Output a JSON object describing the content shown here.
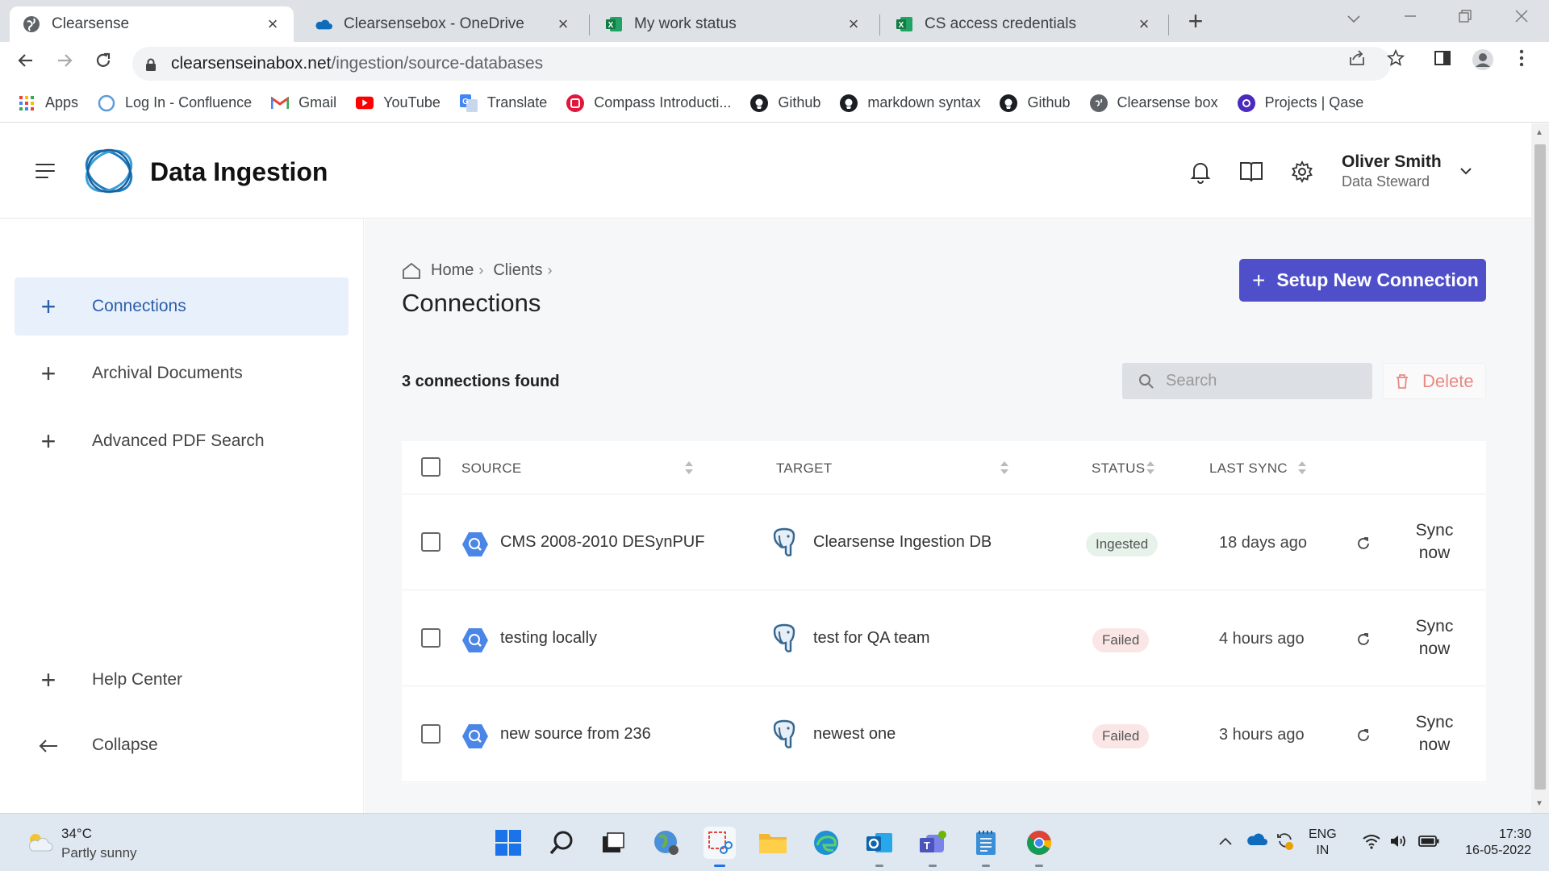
{
  "browser": {
    "tabs": [
      {
        "title": "Clearsense",
        "active": true
      },
      {
        "title": "Clearsensebox - OneDrive",
        "active": false
      },
      {
        "title": "My work status",
        "active": false
      },
      {
        "title": "CS access credentials",
        "active": false
      }
    ],
    "url_host": "clearsenseinabox.net",
    "url_path": "/ingestion/source-databases",
    "bookmarks": [
      {
        "label": "Apps",
        "icon": "apps-grid-icon"
      },
      {
        "label": "Log In - Confluence",
        "icon": "confluence-icon"
      },
      {
        "label": "Gmail",
        "icon": "gmail-icon"
      },
      {
        "label": "YouTube",
        "icon": "youtube-icon"
      },
      {
        "label": "Translate",
        "icon": "translate-icon"
      },
      {
        "label": "Compass Introducti...",
        "icon": "compass-icon"
      },
      {
        "label": "Github",
        "icon": "github-icon"
      },
      {
        "label": "markdown syntax",
        "icon": "github-icon"
      },
      {
        "label": "Github",
        "icon": "github-icon"
      },
      {
        "label": "Clearsense box",
        "icon": "globe-icon"
      },
      {
        "label": "Projects | Qase",
        "icon": "qase-icon"
      }
    ]
  },
  "app": {
    "title": "Data Ingestion",
    "user": {
      "name": "Oliver Smith",
      "role": "Data Steward"
    }
  },
  "sidebar": {
    "items": [
      {
        "label": "Connections",
        "active": true
      },
      {
        "label": "Archival Documents",
        "active": false
      },
      {
        "label": "Advanced PDF Search",
        "active": false
      },
      {
        "label": "Help Center",
        "active": false
      },
      {
        "label": "Collapse",
        "active": false
      }
    ]
  },
  "main": {
    "breadcrumb": [
      "Home",
      "Clients"
    ],
    "title": "Connections",
    "setup_button": "Setup New Connection",
    "count_text": "3 connections found",
    "search_placeholder": "Search",
    "delete_button": "Delete",
    "columns": {
      "source": "SOURCE",
      "target": "TARGET",
      "status": "STATUS",
      "last_sync": "LAST SYNC"
    },
    "rows": [
      {
        "source": "CMS 2008-2010 DESynPUF",
        "target": "Clearsense Ingestion DB",
        "status": "Ingested",
        "last_sync": "18 days ago",
        "action": [
          "Sync",
          "now"
        ]
      },
      {
        "source": "testing locally",
        "target": "test for QA team",
        "status": "Failed",
        "last_sync": "4 hours ago",
        "action": [
          "Sync",
          "now"
        ]
      },
      {
        "source": "new source from 236",
        "target": "newest one",
        "status": "Failed",
        "last_sync": "3 hours ago",
        "action": [
          "Sync",
          "now"
        ]
      }
    ]
  },
  "colors": {
    "primary": "#4f4fc9",
    "sidebar_active_bg": "#e8f0fb",
    "ingested_bg": "#e6f2ea",
    "failed_bg": "#fbe6e6",
    "delete_text": "#e88a82"
  },
  "taskbar": {
    "weather_temp": "34°C",
    "weather_desc": "Partly sunny",
    "lang_line1": "ENG",
    "lang_line2": "IN",
    "time": "17:30",
    "date": "16-05-2022"
  }
}
